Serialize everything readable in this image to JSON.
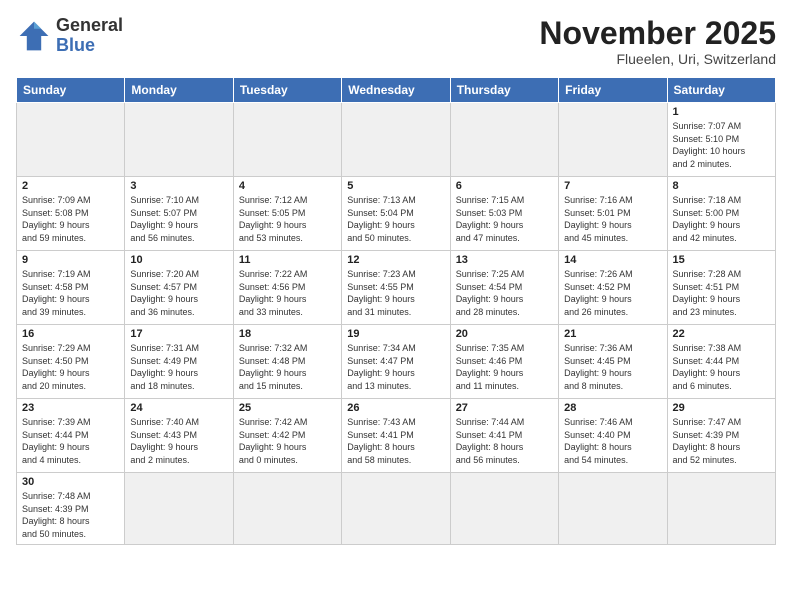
{
  "header": {
    "logo_general": "General",
    "logo_blue": "Blue",
    "title": "November 2025",
    "subtitle": "Flueelen, Uri, Switzerland"
  },
  "weekdays": [
    "Sunday",
    "Monday",
    "Tuesday",
    "Wednesday",
    "Thursday",
    "Friday",
    "Saturday"
  ],
  "weeks": [
    [
      {
        "day": "",
        "info": "",
        "empty": true
      },
      {
        "day": "",
        "info": "",
        "empty": true
      },
      {
        "day": "",
        "info": "",
        "empty": true
      },
      {
        "day": "",
        "info": "",
        "empty": true
      },
      {
        "day": "",
        "info": "",
        "empty": true
      },
      {
        "day": "",
        "info": "",
        "empty": true
      },
      {
        "day": "1",
        "info": "Sunrise: 7:07 AM\nSunset: 5:10 PM\nDaylight: 10 hours\nand 2 minutes."
      }
    ],
    [
      {
        "day": "2",
        "info": "Sunrise: 7:09 AM\nSunset: 5:08 PM\nDaylight: 9 hours\nand 59 minutes."
      },
      {
        "day": "3",
        "info": "Sunrise: 7:10 AM\nSunset: 5:07 PM\nDaylight: 9 hours\nand 56 minutes."
      },
      {
        "day": "4",
        "info": "Sunrise: 7:12 AM\nSunset: 5:05 PM\nDaylight: 9 hours\nand 53 minutes."
      },
      {
        "day": "5",
        "info": "Sunrise: 7:13 AM\nSunset: 5:04 PM\nDaylight: 9 hours\nand 50 minutes."
      },
      {
        "day": "6",
        "info": "Sunrise: 7:15 AM\nSunset: 5:03 PM\nDaylight: 9 hours\nand 47 minutes."
      },
      {
        "day": "7",
        "info": "Sunrise: 7:16 AM\nSunset: 5:01 PM\nDaylight: 9 hours\nand 45 minutes."
      },
      {
        "day": "8",
        "info": "Sunrise: 7:18 AM\nSunset: 5:00 PM\nDaylight: 9 hours\nand 42 minutes."
      }
    ],
    [
      {
        "day": "9",
        "info": "Sunrise: 7:19 AM\nSunset: 4:58 PM\nDaylight: 9 hours\nand 39 minutes."
      },
      {
        "day": "10",
        "info": "Sunrise: 7:20 AM\nSunset: 4:57 PM\nDaylight: 9 hours\nand 36 minutes."
      },
      {
        "day": "11",
        "info": "Sunrise: 7:22 AM\nSunset: 4:56 PM\nDaylight: 9 hours\nand 33 minutes."
      },
      {
        "day": "12",
        "info": "Sunrise: 7:23 AM\nSunset: 4:55 PM\nDaylight: 9 hours\nand 31 minutes."
      },
      {
        "day": "13",
        "info": "Sunrise: 7:25 AM\nSunset: 4:54 PM\nDaylight: 9 hours\nand 28 minutes."
      },
      {
        "day": "14",
        "info": "Sunrise: 7:26 AM\nSunset: 4:52 PM\nDaylight: 9 hours\nand 26 minutes."
      },
      {
        "day": "15",
        "info": "Sunrise: 7:28 AM\nSunset: 4:51 PM\nDaylight: 9 hours\nand 23 minutes."
      }
    ],
    [
      {
        "day": "16",
        "info": "Sunrise: 7:29 AM\nSunset: 4:50 PM\nDaylight: 9 hours\nand 20 minutes."
      },
      {
        "day": "17",
        "info": "Sunrise: 7:31 AM\nSunset: 4:49 PM\nDaylight: 9 hours\nand 18 minutes."
      },
      {
        "day": "18",
        "info": "Sunrise: 7:32 AM\nSunset: 4:48 PM\nDaylight: 9 hours\nand 15 minutes."
      },
      {
        "day": "19",
        "info": "Sunrise: 7:34 AM\nSunset: 4:47 PM\nDaylight: 9 hours\nand 13 minutes."
      },
      {
        "day": "20",
        "info": "Sunrise: 7:35 AM\nSunset: 4:46 PM\nDaylight: 9 hours\nand 11 minutes."
      },
      {
        "day": "21",
        "info": "Sunrise: 7:36 AM\nSunset: 4:45 PM\nDaylight: 9 hours\nand 8 minutes."
      },
      {
        "day": "22",
        "info": "Sunrise: 7:38 AM\nSunset: 4:44 PM\nDaylight: 9 hours\nand 6 minutes."
      }
    ],
    [
      {
        "day": "23",
        "info": "Sunrise: 7:39 AM\nSunset: 4:44 PM\nDaylight: 9 hours\nand 4 minutes."
      },
      {
        "day": "24",
        "info": "Sunrise: 7:40 AM\nSunset: 4:43 PM\nDaylight: 9 hours\nand 2 minutes."
      },
      {
        "day": "25",
        "info": "Sunrise: 7:42 AM\nSunset: 4:42 PM\nDaylight: 9 hours\nand 0 minutes."
      },
      {
        "day": "26",
        "info": "Sunrise: 7:43 AM\nSunset: 4:41 PM\nDaylight: 8 hours\nand 58 minutes."
      },
      {
        "day": "27",
        "info": "Sunrise: 7:44 AM\nSunset: 4:41 PM\nDaylight: 8 hours\nand 56 minutes."
      },
      {
        "day": "28",
        "info": "Sunrise: 7:46 AM\nSunset: 4:40 PM\nDaylight: 8 hours\nand 54 minutes."
      },
      {
        "day": "29",
        "info": "Sunrise: 7:47 AM\nSunset: 4:39 PM\nDaylight: 8 hours\nand 52 minutes."
      }
    ],
    [
      {
        "day": "30",
        "info": "Sunrise: 7:48 AM\nSunset: 4:39 PM\nDaylight: 8 hours\nand 50 minutes."
      },
      {
        "day": "",
        "info": "",
        "empty": true
      },
      {
        "day": "",
        "info": "",
        "empty": true
      },
      {
        "day": "",
        "info": "",
        "empty": true
      },
      {
        "day": "",
        "info": "",
        "empty": true
      },
      {
        "day": "",
        "info": "",
        "empty": true
      },
      {
        "day": "",
        "info": "",
        "empty": true
      }
    ]
  ]
}
